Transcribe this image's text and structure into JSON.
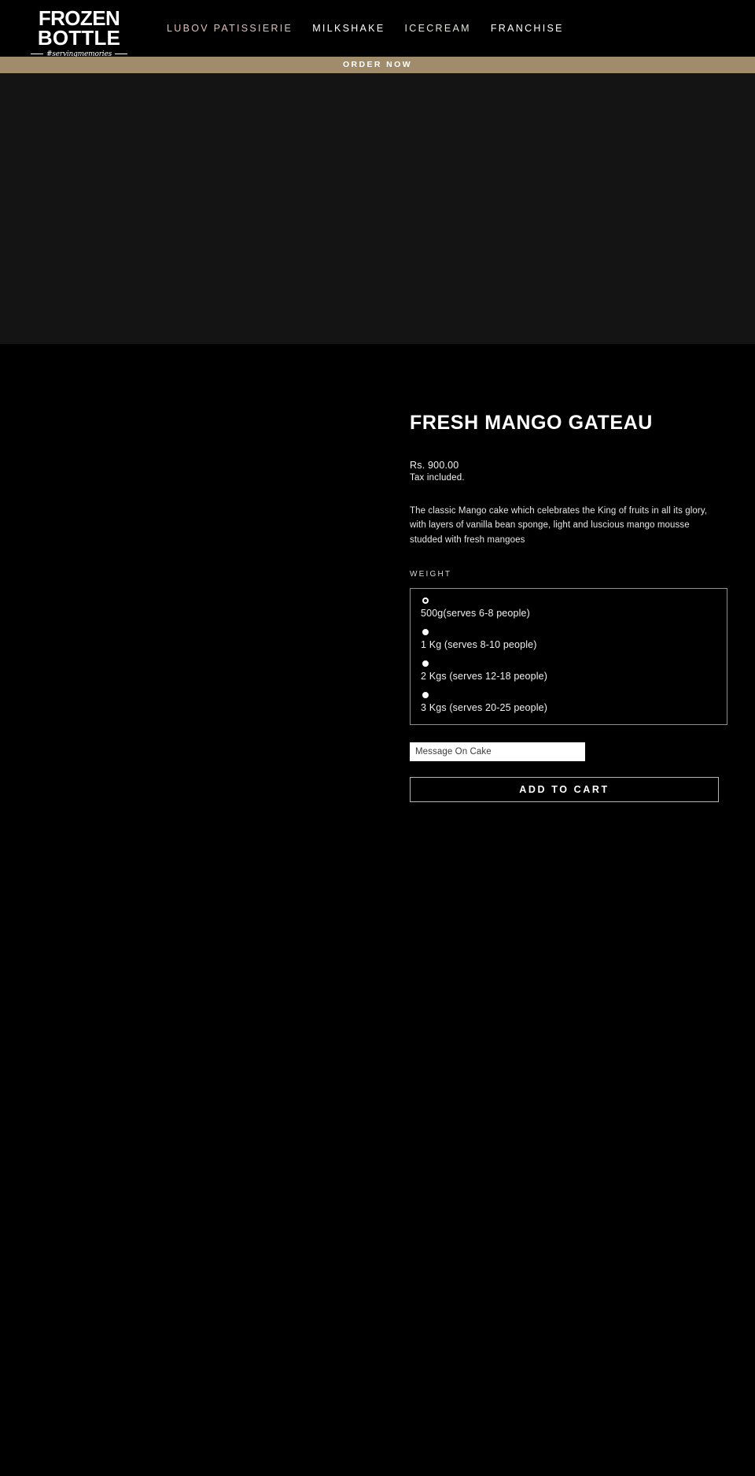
{
  "header": {
    "logo": {
      "line1": "FROZEN",
      "line2": "BOTTLE",
      "tagline": "#servingmemories"
    },
    "nav": [
      {
        "label": "LUBOV PATISSIERIE",
        "color": "#e0bfba"
      },
      {
        "label": "MILKSHAKE",
        "color": "#ffffff"
      },
      {
        "label": "ICECREAM",
        "color": "#dfe7d9"
      },
      {
        "label": "FRANCHISE",
        "color": "#ffffff"
      }
    ]
  },
  "order_bar": {
    "label": "ORDER NOW",
    "background": "#a08c6b",
    "text_color": "#ffffff"
  },
  "product": {
    "title": "FRESH MANGO GATEAU",
    "price": "Rs. 900.00",
    "tax_note": "Tax included.",
    "description": "The classic Mango cake which celebrates the King of fruits in all its glory, with layers of vanilla bean sponge, light and luscious mango mousse studded with fresh mangoes",
    "option_label": "WEIGHT",
    "weight_options": [
      {
        "label": "500g(serves 6-8 people)",
        "selected": true
      },
      {
        "label": "1 Kg (serves 8-10 people)",
        "selected": false
      },
      {
        "label": "2 Kgs (serves 12-18 people)",
        "selected": false
      },
      {
        "label": "3 Kgs (serves 20-25 people)",
        "selected": false
      }
    ],
    "message_field": {
      "placeholder": "Message On Cake",
      "value": ""
    },
    "add_to_cart_label": "ADD TO CART"
  }
}
